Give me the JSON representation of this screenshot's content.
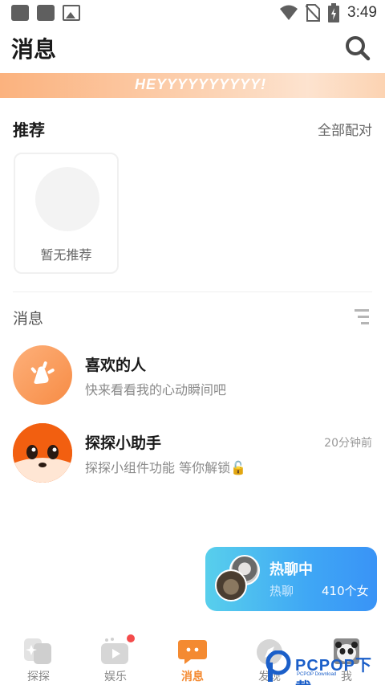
{
  "status_bar": {
    "time": "3:49"
  },
  "header": {
    "title": "消息"
  },
  "banner": {
    "text": "HEYYYYYYYYYY!"
  },
  "recommend": {
    "title": "推荐",
    "all_match": "全部配对",
    "empty_text": "暂无推荐"
  },
  "messages": {
    "label": "消息",
    "items": [
      {
        "name": "喜欢的人",
        "preview": "快来看看我的心动瞬间吧",
        "time": ""
      },
      {
        "name": "探探小助手",
        "preview": "探探小组件功能 等你解锁🔓",
        "time": "20分钟前"
      }
    ]
  },
  "hot_chat": {
    "title": "热聊中",
    "subtitle": "热聊",
    "count": "410个女"
  },
  "tabbar": {
    "tabs": [
      {
        "label": "探探"
      },
      {
        "label": "娱乐"
      },
      {
        "label": "消息"
      },
      {
        "label": "发现"
      },
      {
        "label": "我"
      }
    ]
  },
  "watermark": {
    "text": "PCPOP下载",
    "sub": "PCPOP Download"
  },
  "colors": {
    "accent": "#f48a31",
    "hot_blue": "#3fa7f5",
    "banner": "#fbb27e"
  }
}
